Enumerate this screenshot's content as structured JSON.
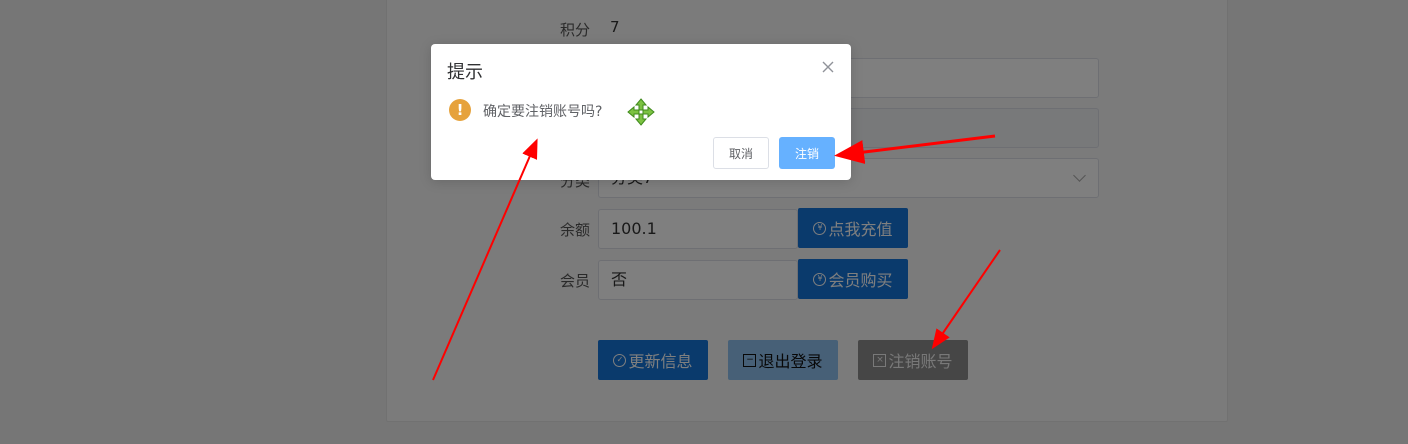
{
  "form": {
    "points_label": "积分",
    "points_value": "7",
    "category_label": "分类",
    "category_value": "分类7",
    "balance_label": "余额",
    "balance_value": "100.1",
    "recharge_label": "点我充值",
    "member_label": "会员",
    "member_value": "否",
    "buy_member_label": "会员购买"
  },
  "actions": {
    "update_label": "更新信息",
    "logout_label": "退出登录",
    "cancel_account_label": "注销账号"
  },
  "dialog": {
    "title": "提示",
    "message": "确定要注销账号吗?",
    "cancel_label": "取消",
    "confirm_label": "注销"
  },
  "colors": {
    "primary": "#1474d8",
    "dialog_confirm": "#66b1ff",
    "warning": "#e6a23c",
    "annotation_arrow": "#ff0000"
  },
  "icons": [
    "close-icon",
    "warning-icon",
    "move-icon",
    "check-circle-icon",
    "minus-square-icon",
    "close-square-icon",
    "yen-circle-icon"
  ]
}
